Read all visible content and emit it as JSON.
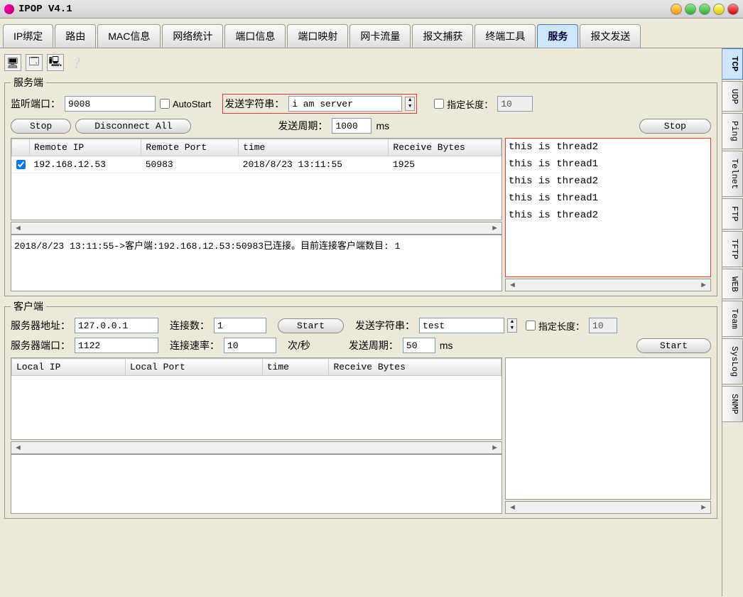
{
  "window": {
    "title": "IPOP V4.1"
  },
  "tabs": {
    "main": [
      "IP绑定",
      "路由",
      "MAC信息",
      "网络统计",
      "端口信息",
      "端口映射",
      "网卡流量",
      "报文捕获",
      "终端工具",
      "服务",
      "报文发送"
    ],
    "main_active": 9,
    "side": [
      "TCP",
      "UDP",
      "Ping",
      "Telnet",
      "FTP",
      "TFTP",
      "WEB",
      "Team",
      "SysLog",
      "SNMP"
    ],
    "side_active": 0
  },
  "server": {
    "legend": "服务端",
    "listen_port_label": "监听端口：",
    "listen_port": "9008",
    "autostart_label": "AutoStart",
    "autostart": false,
    "send_str_label": "发送字符串：",
    "send_str": "i am server",
    "fixed_len_label": "指定长度：",
    "fixed_len_checked": false,
    "fixed_len": "10",
    "stop_btn": "Stop",
    "disconnect_btn": "Disconnect All",
    "send_period_label": "发送周期：",
    "send_period": "1000",
    "send_period_unit": "ms",
    "stop2_btn": "Stop",
    "table_headers": [
      "Remote IP",
      "Remote Port",
      "time",
      "Receive Bytes"
    ],
    "table_rows": [
      {
        "checked": true,
        "ip": "192.168.12.53",
        "port": "50983",
        "time": "2018/8/23 13:11:55",
        "bytes": "1925"
      }
    ],
    "log": "2018/8/23 13:11:55->客户端:192.168.12.53:50983已连接。目前连接客户端数目: 1",
    "recv_lines": [
      "this is thread2",
      "this is thread1",
      "this is thread2",
      "this is thread1",
      "this is thread2"
    ]
  },
  "client": {
    "legend": "客户端",
    "server_addr_label": "服务器地址：",
    "server_addr": "127.0.0.1",
    "conn_count_label": "连接数：",
    "conn_count": "1",
    "start_btn": "Start",
    "send_str_label": "发送字符串：",
    "send_str": "test",
    "fixed_len_label": "指定长度：",
    "fixed_len_checked": false,
    "fixed_len": "10",
    "server_port_label": "服务器端口：",
    "server_port": "1122",
    "conn_rate_label": "连接速率：",
    "conn_rate": "10",
    "conn_rate_unit": "次/秒",
    "send_period_label": "发送周期：",
    "send_period": "50",
    "send_period_unit": "ms",
    "start2_btn": "Start",
    "table_headers": [
      "Local IP",
      "Local Port",
      "time",
      "Receive Bytes"
    ],
    "log": "",
    "recv": ""
  }
}
